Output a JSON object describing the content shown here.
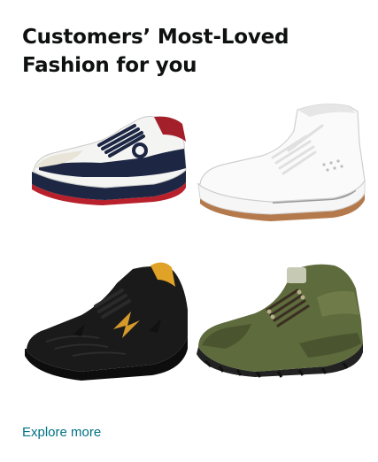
{
  "card": {
    "title_line1": "Customers’ Most-Loved",
    "title_line2": "Fashion for you",
    "products": [
      {
        "id": "product-1",
        "icon": "sneaker-white-navy-red-icon"
      },
      {
        "id": "product-2",
        "icon": "high-top-white-sneaker-icon"
      },
      {
        "id": "product-3",
        "icon": "black-running-shoe-icon"
      },
      {
        "id": "product-4",
        "icon": "olive-hiking-shoe-icon"
      }
    ],
    "explore_label": "Explore more"
  },
  "colors": {
    "title": "#0f1111",
    "link": "#007185",
    "background": "#ffffff"
  }
}
